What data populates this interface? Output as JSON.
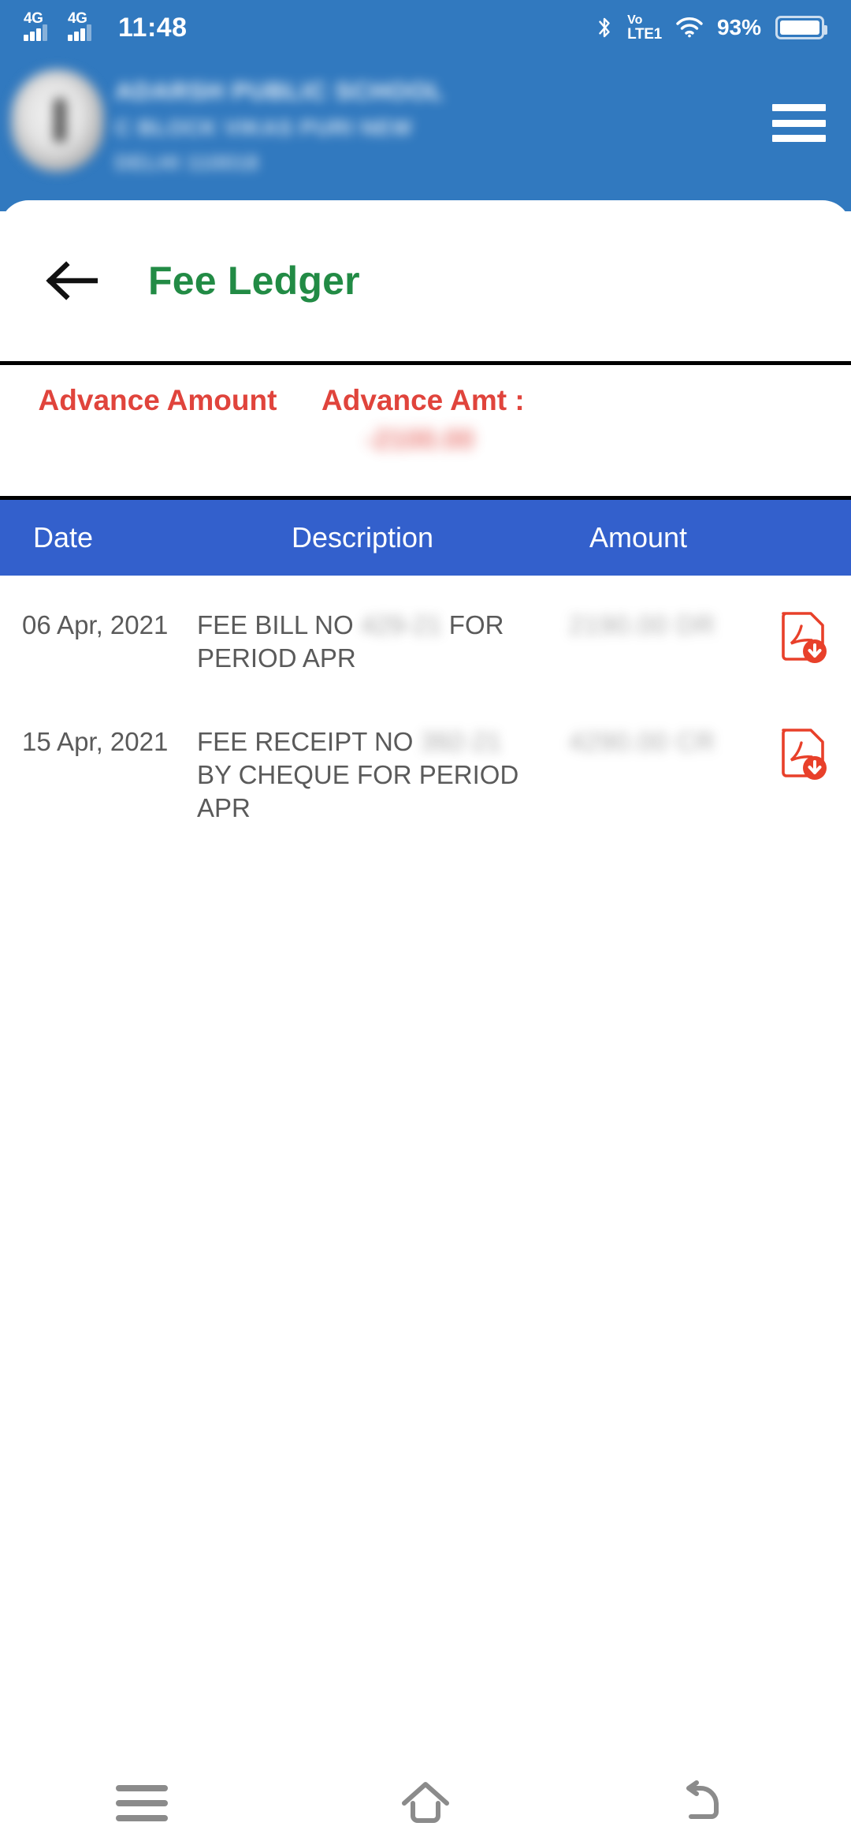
{
  "status_bar": {
    "time": "11:48",
    "sim1_network": "4G",
    "sim2_network": "4G",
    "bluetooth_icon": "bluetooth-icon",
    "volte_line1": "Vo",
    "volte_line2": "LTE1",
    "wifi_icon": "wifi-icon",
    "battery_percent": "93%",
    "battery_icon": "battery-icon"
  },
  "app_header": {
    "logo_icon": "school-logo",
    "school_name_line1": "ADARSH PUBLIC SCHOOL",
    "school_name_line2": "C BLOCK VIKAS PURI NEW",
    "school_name_line3": "DELHI 110018",
    "menu_icon": "hamburger-menu-icon",
    "header_color": "#3179bf"
  },
  "screen": {
    "back_icon": "back-arrow-icon",
    "title": "Fee Ledger",
    "title_color": "#228b45"
  },
  "advance": {
    "label": "Advance Amount",
    "amount_label": "Advance Amt :",
    "amount_value": "-2100.00",
    "text_color": "#e0443c"
  },
  "table": {
    "header_color": "#3360cc",
    "columns": [
      "Date",
      "Description",
      "Amount"
    ],
    "rows": [
      {
        "date": "06 Apr, 2021",
        "description_prefix": "FEE BILL NO",
        "description_redacted": "429-21",
        "description_suffix": "FOR PERIOD APR",
        "amount": "2190.00 DR",
        "action_icon": "pdf-download-icon"
      },
      {
        "date": "15 Apr, 2021",
        "description_prefix": "FEE RECEIPT NO",
        "description_redacted": "392-21",
        "description_suffix": "BY CHEQUE FOR PERIOD APR",
        "amount": "4290.00 CR",
        "action_icon": "pdf-download-icon"
      }
    ]
  },
  "navigation_bar": {
    "recents_icon": "recents-icon",
    "home_icon": "home-icon",
    "back_icon": "back-nav-icon"
  }
}
